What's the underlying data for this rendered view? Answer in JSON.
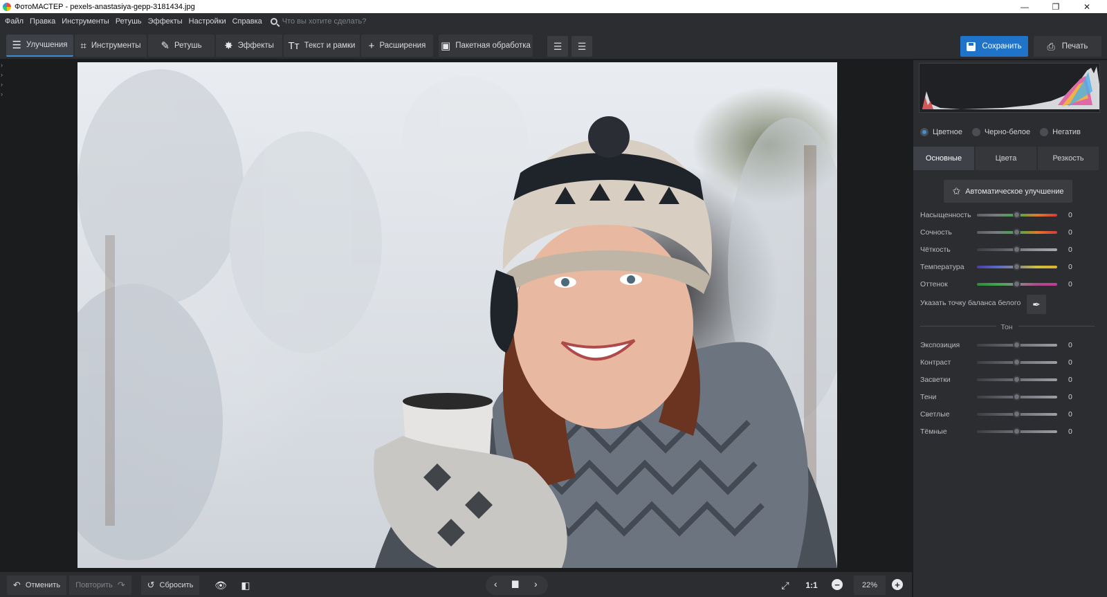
{
  "window": {
    "title": "ФотоМАСТЕР - pexels-anastasiya-gepp-3181434.jpg",
    "controls": [
      "—",
      "❐",
      "✕"
    ]
  },
  "menu": {
    "items": [
      "Файл",
      "Правка",
      "Инструменты",
      "Ретушь",
      "Эффекты",
      "Настройки",
      "Справка"
    ],
    "search_placeholder": "Что вы хотите сделать?"
  },
  "toolbar": {
    "tabs": [
      {
        "label": "Улучшения",
        "icon": "sliders-icon",
        "glyph": "☰"
      },
      {
        "label": "Инструменты",
        "icon": "crop-icon",
        "glyph": "⌗"
      },
      {
        "label": "Ретушь",
        "icon": "brush-icon",
        "glyph": "✎"
      },
      {
        "label": "Эффекты",
        "icon": "sparkle-icon",
        "glyph": "✸"
      },
      {
        "label": "Текст и рамки",
        "icon": "text-icon",
        "glyph": "Tт"
      },
      {
        "label": "Расширения",
        "icon": "plus-icon",
        "glyph": "+"
      },
      {
        "label": "Пакетная обработка",
        "icon": "batch-icon",
        "glyph": "▣"
      }
    ],
    "save_label": "Сохранить",
    "print_label": "Печать"
  },
  "bottom": {
    "undo_label": "Отменить",
    "redo_label": "Повторить",
    "reset_label": "Сбросить",
    "one_to_one": "1:1",
    "zoom": "22%"
  },
  "panel": {
    "modes": [
      {
        "label": "Цветное",
        "selected": true
      },
      {
        "label": "Черно-белое",
        "selected": false
      },
      {
        "label": "Негатив",
        "selected": false
      }
    ],
    "tabs": [
      "Основные",
      "Цвета",
      "Резкость"
    ],
    "auto_label": "Автоматическое улучшение",
    "color_sliders": [
      {
        "label": "Насыщенность",
        "value": "0",
        "gradient": [
          "#5b5e63",
          "#7a7d82",
          "#3fae4a",
          "#e07a2a",
          "#d23a3a"
        ]
      },
      {
        "label": "Сочность",
        "value": "0",
        "gradient": [
          "#5b5e63",
          "#7a7d82",
          "#3fae4a",
          "#e07a2a",
          "#d23a3a"
        ]
      },
      {
        "label": "Чёткость",
        "value": "0",
        "gradient": [
          "#3c3e42",
          "#5b5e63",
          "#8a8d92",
          "#a7aaaf"
        ]
      },
      {
        "label": "Температура",
        "value": "0",
        "gradient": [
          "#4a3fa0",
          "#5a6ac8",
          "#8a8a8a",
          "#d0c040",
          "#e0b030"
        ]
      },
      {
        "label": "Оттенок",
        "value": "0",
        "gradient": [
          "#2e8a3a",
          "#3fa84a",
          "#8a8a8a",
          "#b04a8a",
          "#c23a9a"
        ]
      }
    ],
    "wb_label": "Указать точку баланса белого",
    "tone_title": "Тон",
    "tone_sliders": [
      {
        "label": "Экспозиция",
        "value": "0"
      },
      {
        "label": "Контраст",
        "value": "0"
      },
      {
        "label": "Засветки",
        "value": "0"
      },
      {
        "label": "Тени",
        "value": "0"
      },
      {
        "label": "Светлые",
        "value": "0"
      },
      {
        "label": "Тёмные",
        "value": "0"
      }
    ]
  },
  "colors": {
    "accent": "#1f73c9",
    "active_tab_underline": "#3f8fd6",
    "panel_bg": "#2b2d30",
    "app_bg": "#1b1c1e"
  }
}
